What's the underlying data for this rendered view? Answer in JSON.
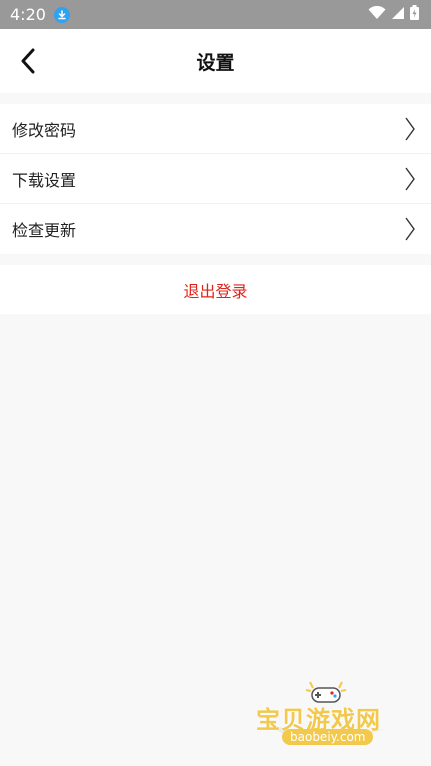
{
  "status_bar": {
    "time": "4:20",
    "icons": [
      "download-icon",
      "wifi-icon",
      "signal-icon",
      "battery-icon"
    ]
  },
  "header": {
    "title": "设置",
    "back_icon": "chevron-left-icon"
  },
  "menu": {
    "items": [
      {
        "label": "修改密码",
        "icon": "chevron-right-icon"
      },
      {
        "label": "下载设置",
        "icon": "chevron-right-icon"
      },
      {
        "label": "检查更新",
        "icon": "chevron-right-icon"
      }
    ]
  },
  "logout": {
    "label": "退出登录",
    "color": "#e0241b"
  },
  "watermark": {
    "title": "宝贝游戏网",
    "url": "baobeiy.com"
  },
  "colors": {
    "status_bar_bg": "#999999",
    "page_bg": "#f8f8f8",
    "card_bg": "#ffffff",
    "accent_download": "#2ea3f2",
    "watermark_yellow": "#f2c94c"
  }
}
